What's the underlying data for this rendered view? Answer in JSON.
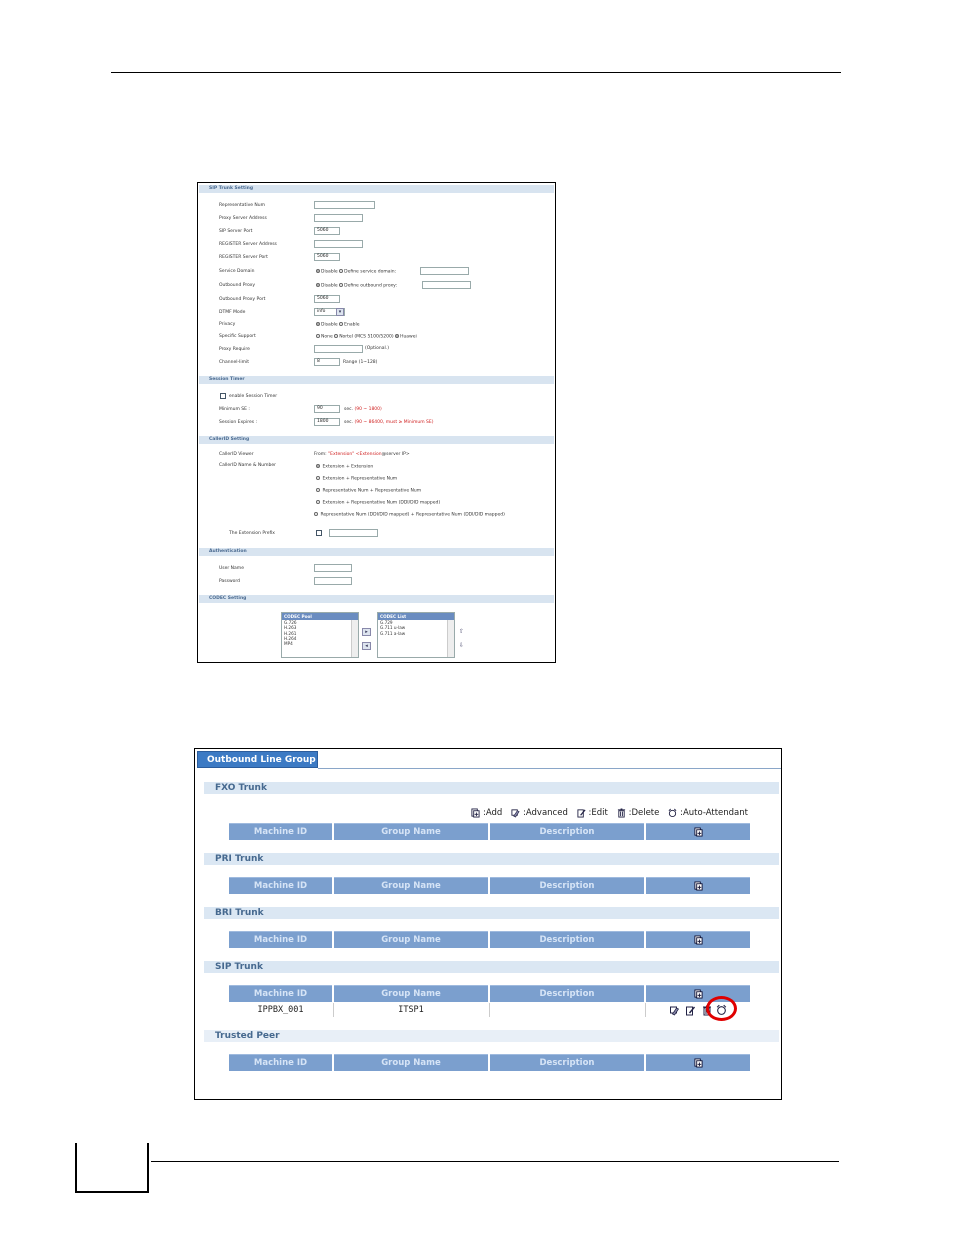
{
  "sip_settings": {
    "sections": {
      "trunk": "SIP Trunk Setting",
      "timer": "Session Timer",
      "callerid": "CallerID Setting",
      "auth": "Authentication",
      "codec": "CODEC Setting"
    },
    "fields": {
      "rep_num": "Representative Num",
      "proxy_addr": "Proxy Server Address",
      "sip_port": "SIP Server Port",
      "sip_port_val": "5060",
      "reg_addr": "REGISTER Server Address",
      "reg_port": "REGISTER Server Port",
      "reg_port_val": "5060",
      "service_domain": "Service Domain",
      "sd_opt1": "Disable",
      "sd_opt2": "Define service domain:",
      "outbound_proxy": "Outbound Proxy",
      "op_opt1": "Disable",
      "op_opt2": "Define outbound proxy:",
      "op_port": "Outbound Proxy Port",
      "op_port_val": "5060",
      "dtmf": "DTMF Mode",
      "dtmf_val": "info",
      "privacy": "Privacy",
      "priv_opt1": "Disable",
      "priv_opt2": "Enable",
      "specific": "Specific Support",
      "spec_opt1": "None",
      "spec_opt2": "Nortel (MCS 5100/5200)",
      "spec_opt3": "Huawei",
      "proxy_req": "Proxy Require",
      "optional": "(Optional.)",
      "channel": "Channel-limit",
      "channel_val": "8",
      "range": "Range (1~128)"
    },
    "timer": {
      "enable": "enable Session Timer",
      "min_se": "Minimum SE :",
      "min_se_val": "90",
      "min_se_hint_prefix": "sec.",
      "min_se_hint": "(90 ~ 1800)",
      "expires": "Session Expires :",
      "expires_val": "1800",
      "expires_hint_prefix": "sec.",
      "expires_hint": "(90 ~ 86400, must ≥ Minimum SE)"
    },
    "callerid": {
      "viewer": "CallerID Viewer",
      "viewer_from": "From:",
      "viewer_ext": "\"Extension\"",
      "viewer_ext2": "<Extension",
      "viewer_tail": "@server IP>",
      "name_num": "CallerID Name & Number",
      "opt1": "Extension + Extension",
      "opt2": "Extension + Representative Num",
      "opt3": "Representative Num + Representative Num",
      "opt4": "Extension + Representative Num (DDI/DID mapped)",
      "opt5": "Representative Num (DDI/DID mapped) + Representative Num (DDI/DID mapped)",
      "prefix": "The Extension Prefix"
    },
    "auth": {
      "user": "User Name",
      "password": "Password"
    },
    "codec": {
      "pool_title": "CODEC Pool",
      "pool": [
        "G.726",
        "H.263",
        "H.261",
        "H.264",
        "MP4"
      ],
      "list_title": "CODEC List",
      "list": [
        "G.729",
        "G.711 u-law",
        "G.711 a-law"
      ]
    }
  },
  "outbound": {
    "tab": "Outbound Line Group",
    "legend": {
      "add": ":Add",
      "advanced": ":Advanced",
      "edit": ":Edit",
      "delete": ":Delete",
      "auto": ":Auto-Attendant"
    },
    "columns": [
      "Machine ID",
      "Group Name",
      "Description"
    ],
    "sections": [
      "FXO Trunk",
      "PRI Trunk",
      "BRI Trunk",
      "SIP Trunk",
      "Trusted Peer"
    ],
    "sip_row": {
      "machine_id": "IPPBX_001",
      "group_name": "ITSP1",
      "description": ""
    }
  },
  "colors": {
    "header": "#7b9fce",
    "section": "#dbe7f3",
    "tab": "#3c7ac4",
    "highlight": "#e00000"
  }
}
